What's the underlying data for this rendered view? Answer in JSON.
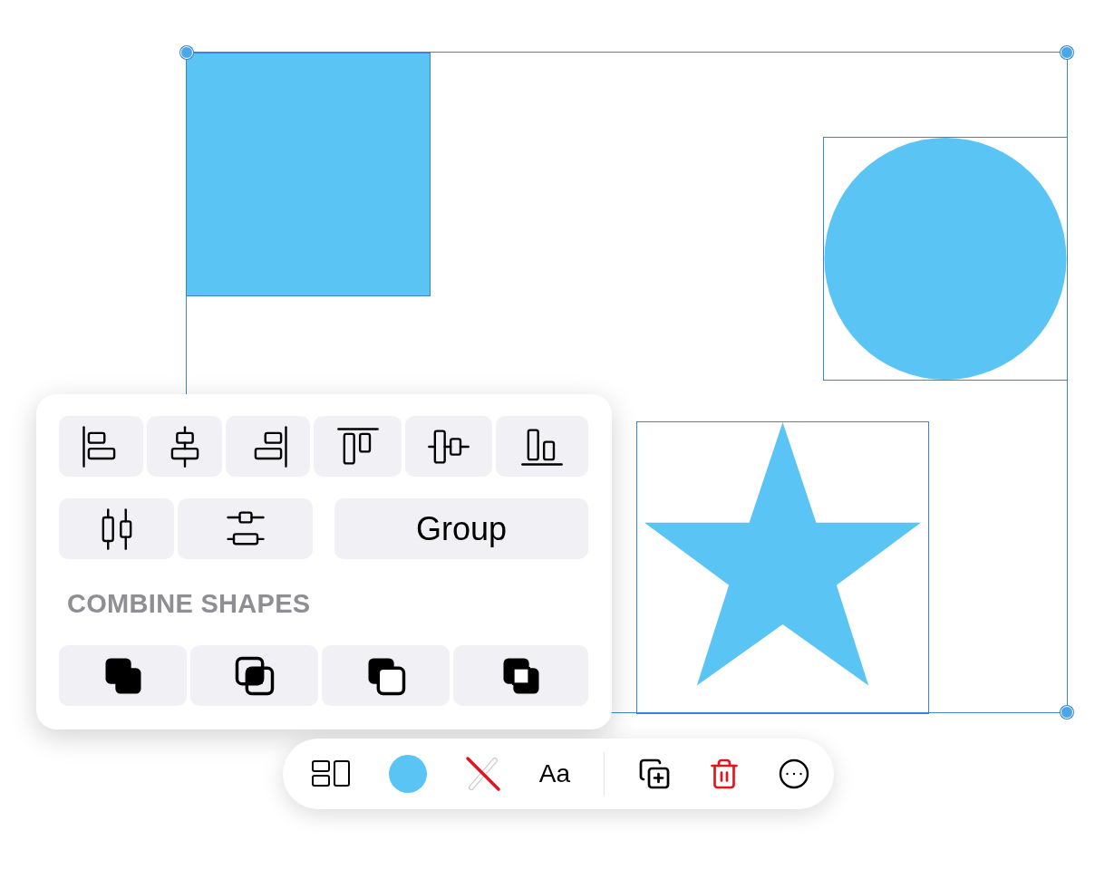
{
  "canvas": {
    "shapes": [
      {
        "kind": "square"
      },
      {
        "kind": "circle"
      },
      {
        "kind": "star"
      }
    ]
  },
  "popover": {
    "align_buttons": [
      {
        "kind": "align-left"
      },
      {
        "kind": "align-center"
      },
      {
        "kind": "align-right"
      },
      {
        "kind": "align-top"
      },
      {
        "kind": "align-middle"
      },
      {
        "kind": "align-bottom"
      }
    ],
    "distribute_buttons": [
      {
        "kind": "distribute-horizontal"
      },
      {
        "kind": "distribute-vertical"
      }
    ],
    "group_button": "Group",
    "section_title": "COMBINE SHAPES",
    "combine_buttons": [
      {
        "kind": "union"
      },
      {
        "kind": "intersect"
      },
      {
        "kind": "subtract"
      },
      {
        "kind": "exclude"
      }
    ]
  },
  "toolbar": {
    "items": [
      {
        "kind": "arrange"
      },
      {
        "kind": "fill"
      },
      {
        "kind": "stroke"
      },
      {
        "kind": "text",
        "label": "Aa"
      },
      {
        "kind": "divider"
      },
      {
        "kind": "duplicate"
      },
      {
        "kind": "delete"
      },
      {
        "kind": "more"
      }
    ]
  }
}
